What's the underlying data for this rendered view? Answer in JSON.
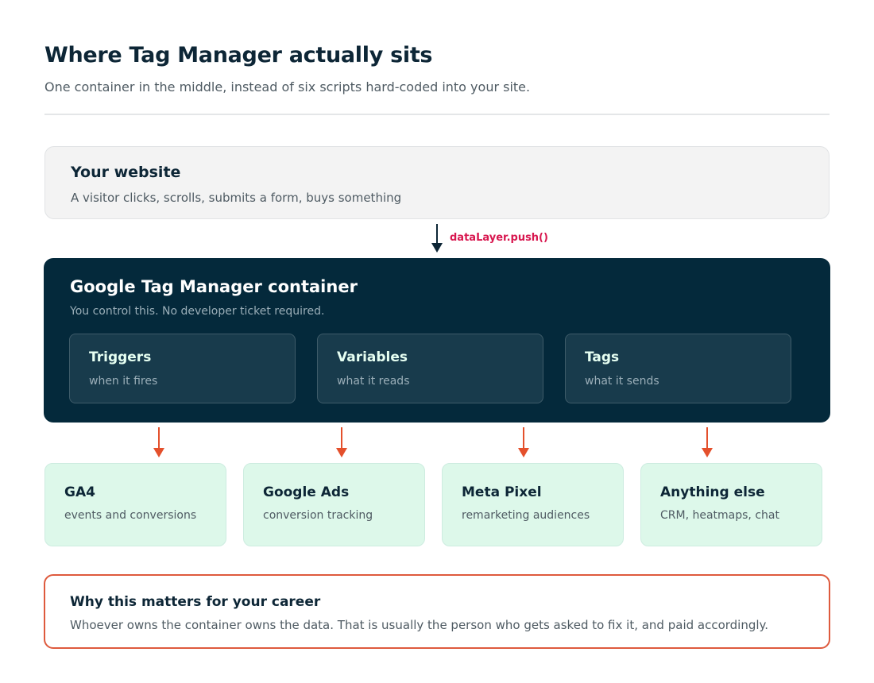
{
  "header": {
    "title": "Where Tag Manager actually sits",
    "subtitle": "One container in the middle, instead of six scripts hard-coded into your site."
  },
  "website": {
    "title": "Your website",
    "description": "A visitor clicks, scrolls, submits a form, buys something"
  },
  "connector": {
    "label": "dataLayer.push()"
  },
  "container": {
    "title": "Google Tag Manager container",
    "description": "You control this. No developer ticket required.",
    "parts": [
      {
        "title": "Triggers",
        "description": "when it fires"
      },
      {
        "title": "Variables",
        "description": "what it reads"
      },
      {
        "title": "Tags",
        "description": "what it sends"
      }
    ]
  },
  "destinations": [
    {
      "title": "GA4",
      "description": "events and conversions"
    },
    {
      "title": "Google Ads",
      "description": "conversion tracking"
    },
    {
      "title": "Meta Pixel",
      "description": "remarketing audiences"
    },
    {
      "title": "Anything else",
      "description": "CRM, heatmaps, chat"
    }
  ],
  "career": {
    "title": "Why this matters for your career",
    "description": "Whoever owns the container owns the data. That is usually the person who gets asked to fix it, and paid accordingly."
  },
  "colors": {
    "container_bg": "#04293b",
    "accent_arrow": "#e4502c",
    "push_label": "#d8174f",
    "destination_bg": "#ddf8ea",
    "career_border": "#de5a3d"
  }
}
